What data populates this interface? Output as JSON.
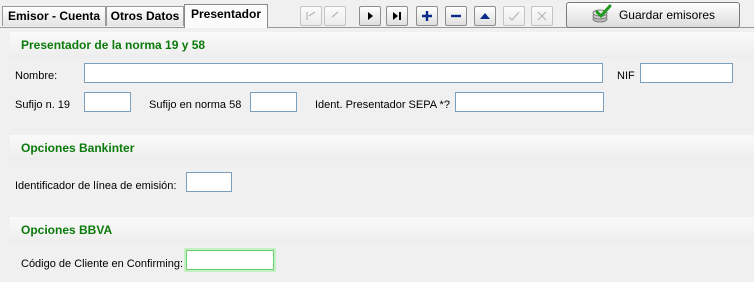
{
  "tabs": [
    {
      "label": "Emisor - Cuenta"
    },
    {
      "label": "Otros Datos"
    },
    {
      "label": "Presentador"
    }
  ],
  "toolbar": {
    "nav_icons": [
      "first-record-icon",
      "prior-record-icon",
      "next-record-icon",
      "last-record-icon",
      "insert-record-icon",
      "delete-record-icon",
      "edit-record-icon",
      "post-record-icon",
      "cancel-record-icon"
    ],
    "save_label": "Guardar emisores"
  },
  "presentador": {
    "title": "Presentador de la norma 19 y 58",
    "nombre_label": "Nombre:",
    "nombre_value": "",
    "nif_label": "NIF",
    "nif_value": "",
    "sufijo19_label": "Sufijo n. 19",
    "sufijo19_value": "",
    "sufijo58_label": "Sufijo en norma 58",
    "sufijo58_value": "",
    "sepa_label": "Ident. Presentador SEPA *?",
    "sepa_value": ""
  },
  "bankinter": {
    "title": "Opciones Bankinter",
    "linea_label": "Identificador de línea de emisión:",
    "linea_value": ""
  },
  "bbva": {
    "title": "Opciones BBVA",
    "confirming_label": "Código de Cliente en Confirming:",
    "confirming_value": ""
  },
  "colors": {
    "section_title": "#0b7a0b",
    "focus_glow": "#6bd36b",
    "field_border": "#7b9ebd"
  }
}
